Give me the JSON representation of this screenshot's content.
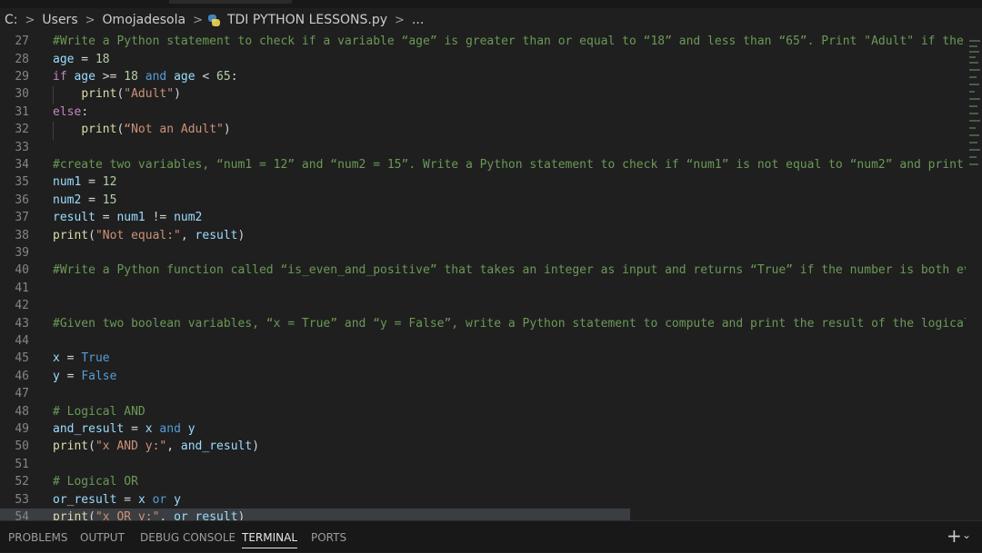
{
  "breadcrumb": {
    "drive": "C:",
    "sep": ">",
    "users": "Users",
    "user": "Omojadesola",
    "file": "TDI PYTHON LESSONS.py",
    "ellipsis": "..."
  },
  "line_numbers": [
    "27",
    "28",
    "29",
    "30",
    "31",
    "32",
    "33",
    "34",
    "35",
    "36",
    "37",
    "38",
    "39",
    "40",
    "41",
    "42",
    "43",
    "44",
    "45",
    "46",
    "47",
    "48",
    "49",
    "50",
    "51",
    "52",
    "53",
    "54"
  ],
  "code": {
    "l27": "#Write a Python statement to check if a variable “age” is greater than or equal to “18” and less than “65”. Print \"Adult\" if the",
    "l28_var": "age",
    "l28_op": " = ",
    "l28_num": "18",
    "l29_if": "if",
    "l29_var": "age",
    "l29_op1": " >= ",
    "l29_num1": "18",
    "l29_and": "and",
    "l29_var2": "age",
    "l29_op2": " < ",
    "l29_num2": "65",
    "l29_colon": ":",
    "l30_fn": "print",
    "l30_str": "\"Adult\"",
    "l31_else": "else",
    "l31_colon": ":",
    "l32_fn": "print",
    "l32_str": "“Not an Adult\"",
    "l34": "#create two variables, “num1 = 12” and “num2 = 15”. Write a Python statement to check if “num1” is not equal to “num2” and print",
    "l35_var": "num1",
    "l35_num": "12",
    "l36_var": "num2",
    "l36_num": "15",
    "l37_var": "result",
    "l37_v1": "num1",
    "l37_op": " != ",
    "l37_v2": "num2",
    "l38_fn": "print",
    "l38_str": "\"Not equal:\"",
    "l38_var": "result",
    "l40": "#Write a Python function called “is_even_and_positive” that takes an integer as input and returns “True” if the number is both ev",
    "l43": "#Given two boolean variables, “x = True” and “y = False”, write a Python statement to compute and print the result of the logical",
    "l45_var": "x",
    "l45_val": "True",
    "l46_var": "y",
    "l46_val": "False",
    "l48": "# Logical AND",
    "l49_var": "and_result",
    "l49_x": "x",
    "l49_and": "and",
    "l49_y": "y",
    "l50_fn": "print",
    "l50_str": "\"x AND y:\"",
    "l50_var": "and_result",
    "l52": "# Logical OR",
    "l53_var": "or_result",
    "l53_x": "x",
    "l53_or": "or",
    "l53_y": "y",
    "l54_fn": "print",
    "l54_str": "\"x OR y:\"",
    "l54_var": "or_result"
  },
  "panel": {
    "tabs": [
      "PROBLEMS",
      "OUTPUT",
      "DEBUG CONSOLE",
      "TERMINAL",
      "PORTS"
    ],
    "active": "TERMINAL",
    "plus": "+",
    "caret": "⌄"
  },
  "colors": {
    "background": "#1f1f1f",
    "comment": "#6a9955",
    "keyword": "#c586c0",
    "variable": "#9cdcfe",
    "number": "#b5cea8",
    "string": "#ce9178",
    "function": "#dcdcaa"
  }
}
